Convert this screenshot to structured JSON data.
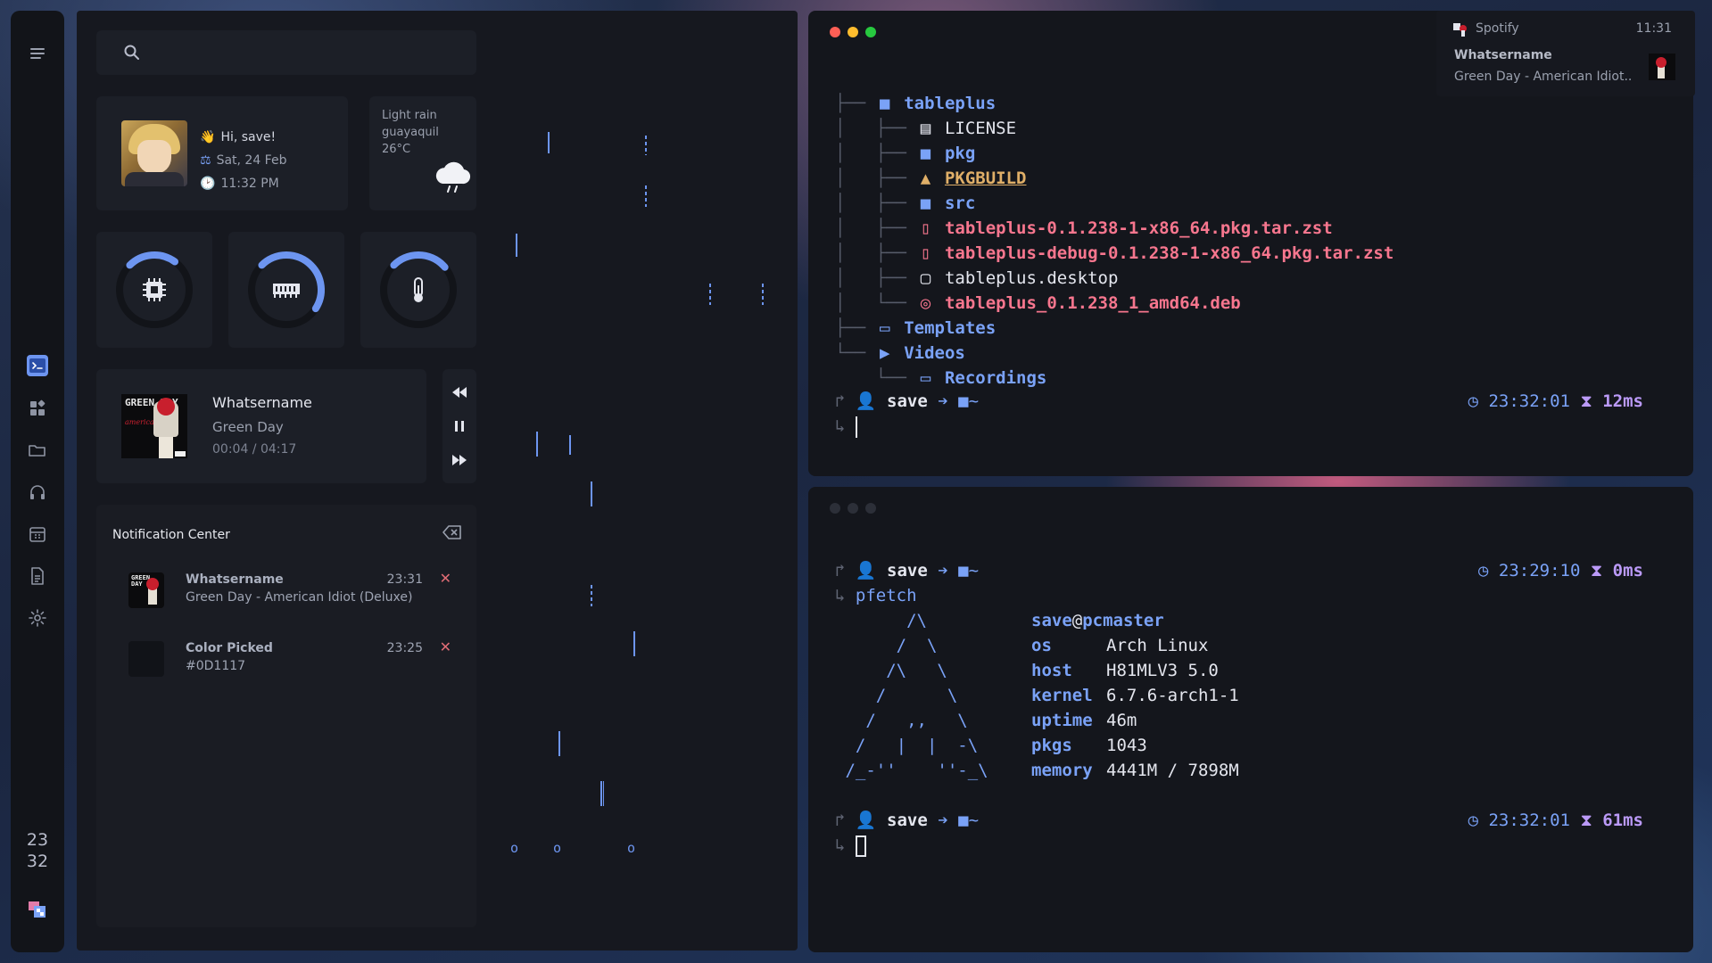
{
  "sidebar": {
    "icons": [
      "menu-icon",
      "terminal-icon",
      "apps-icon",
      "folder-icon",
      "headphones-icon",
      "calendar-icon",
      "document-icon",
      "gear-icon",
      "color-palette-icon"
    ],
    "clock_hour": "23",
    "clock_minute": "32"
  },
  "greeting": {
    "hello": "Hi, save!",
    "date": "Sat, 24 Feb",
    "time": "11:32 PM"
  },
  "weather": {
    "condition": "Light rain",
    "city": "guayaquil",
    "temp": "26°C"
  },
  "gauges": [
    {
      "name": "cpu",
      "icon": "cpu-icon",
      "fraction": 0.3
    },
    {
      "name": "memory",
      "icon": "ram-icon",
      "fraction": 0.62
    },
    {
      "name": "temperature",
      "icon": "thermometer-icon",
      "fraction": 0.35
    }
  ],
  "media": {
    "title": "Whatsername",
    "artist": "Green Day",
    "progress": "00:04 / 04:17",
    "cover_text": "GREEN DAY",
    "cover_subtext": "american idiot"
  },
  "notifications": {
    "title": "Notification Center",
    "items": [
      {
        "name": "Whatsername",
        "body": "Green Day - American Idiot (Deluxe)",
        "time": "23:31"
      },
      {
        "name": "Color Picked",
        "body": "#0D1117",
        "time": "23:25"
      }
    ]
  },
  "terminal_top": {
    "tree": [
      {
        "prefix": "├── ",
        "icon": "folder",
        "name": "tableplus",
        "kind": "dir"
      },
      {
        "prefix": "│   ├── ",
        "icon": "book",
        "name": "LICENSE",
        "kind": "file"
      },
      {
        "prefix": "│   ├── ",
        "icon": "folder",
        "name": "pkg",
        "kind": "dir"
      },
      {
        "prefix": "│   ├── ",
        "icon": "arch",
        "name": "PKGBUILD",
        "kind": "build"
      },
      {
        "prefix": "│   ├── ",
        "icon": "folder",
        "name": "src",
        "kind": "dir"
      },
      {
        "prefix": "│   ├── ",
        "icon": "archive",
        "name": "tableplus-0.1.238-1-x86_64.pkg.tar.zst",
        "kind": "pkg"
      },
      {
        "prefix": "│   ├── ",
        "icon": "archive",
        "name": "tableplus-debug-0.1.238-1-x86_64.pkg.tar.zst",
        "kind": "pkg"
      },
      {
        "prefix": "│   ├── ",
        "icon": "desktop",
        "name": "tableplus.desktop",
        "kind": "file"
      },
      {
        "prefix": "│   └── ",
        "icon": "deb",
        "name": "tableplus_0.1.238_1_amd64.deb",
        "kind": "pkg"
      },
      {
        "prefix": "├── ",
        "icon": "folder-open",
        "name": "Templates",
        "kind": "dir"
      },
      {
        "prefix": "└── ",
        "icon": "video",
        "name": "Videos",
        "kind": "dir"
      },
      {
        "prefix": "    └── ",
        "icon": "folder-open",
        "name": "Recordings",
        "kind": "dir"
      }
    ],
    "prompt_user": "save",
    "prompt_dir": "~",
    "prompt_time": "23:32:01",
    "prompt_duration": "12ms"
  },
  "terminal_bottom": {
    "prompt1_user": "save",
    "prompt1_dir": "~",
    "prompt1_time": "23:29:10",
    "prompt1_duration": "0ms",
    "command": "pfetch",
    "logo": [
      "       /\\",
      "      /  \\",
      "     /\\   \\",
      "    /      \\",
      "   /   ,,   \\",
      "  /   |  |  -\\",
      " /_-''    ''-_\\"
    ],
    "userhost_user": "save",
    "userhost_at": "@",
    "userhost_host": "pcmaster",
    "info": [
      {
        "key": "os",
        "value": "Arch Linux"
      },
      {
        "key": "host",
        "value": "H81MLV3 5.0"
      },
      {
        "key": "kernel",
        "value": "6.7.6-arch1-1"
      },
      {
        "key": "uptime",
        "value": "46m"
      },
      {
        "key": "pkgs",
        "value": "1043"
      },
      {
        "key": "memory",
        "value": "4441M / 7898M"
      }
    ],
    "prompt2_user": "save",
    "prompt2_dir": "~",
    "prompt2_time": "23:32:01",
    "prompt2_duration": "61ms"
  },
  "spotify_popup": {
    "app": "Spotify",
    "time": "11:31",
    "title": "Whatsername",
    "body": "Green Day - American Idiot.."
  },
  "colors": {
    "accent": "#6d95f0",
    "dir_blue": "#7aa2f7",
    "pkg_red": "#f7768e",
    "build_yellow": "#e0af68",
    "duration_purple": "#bb9af7",
    "close_red": "#e06c75",
    "terminal_close": "#ff5f56",
    "terminal_min": "#ffbd2e",
    "terminal_max": "#27c93f"
  }
}
